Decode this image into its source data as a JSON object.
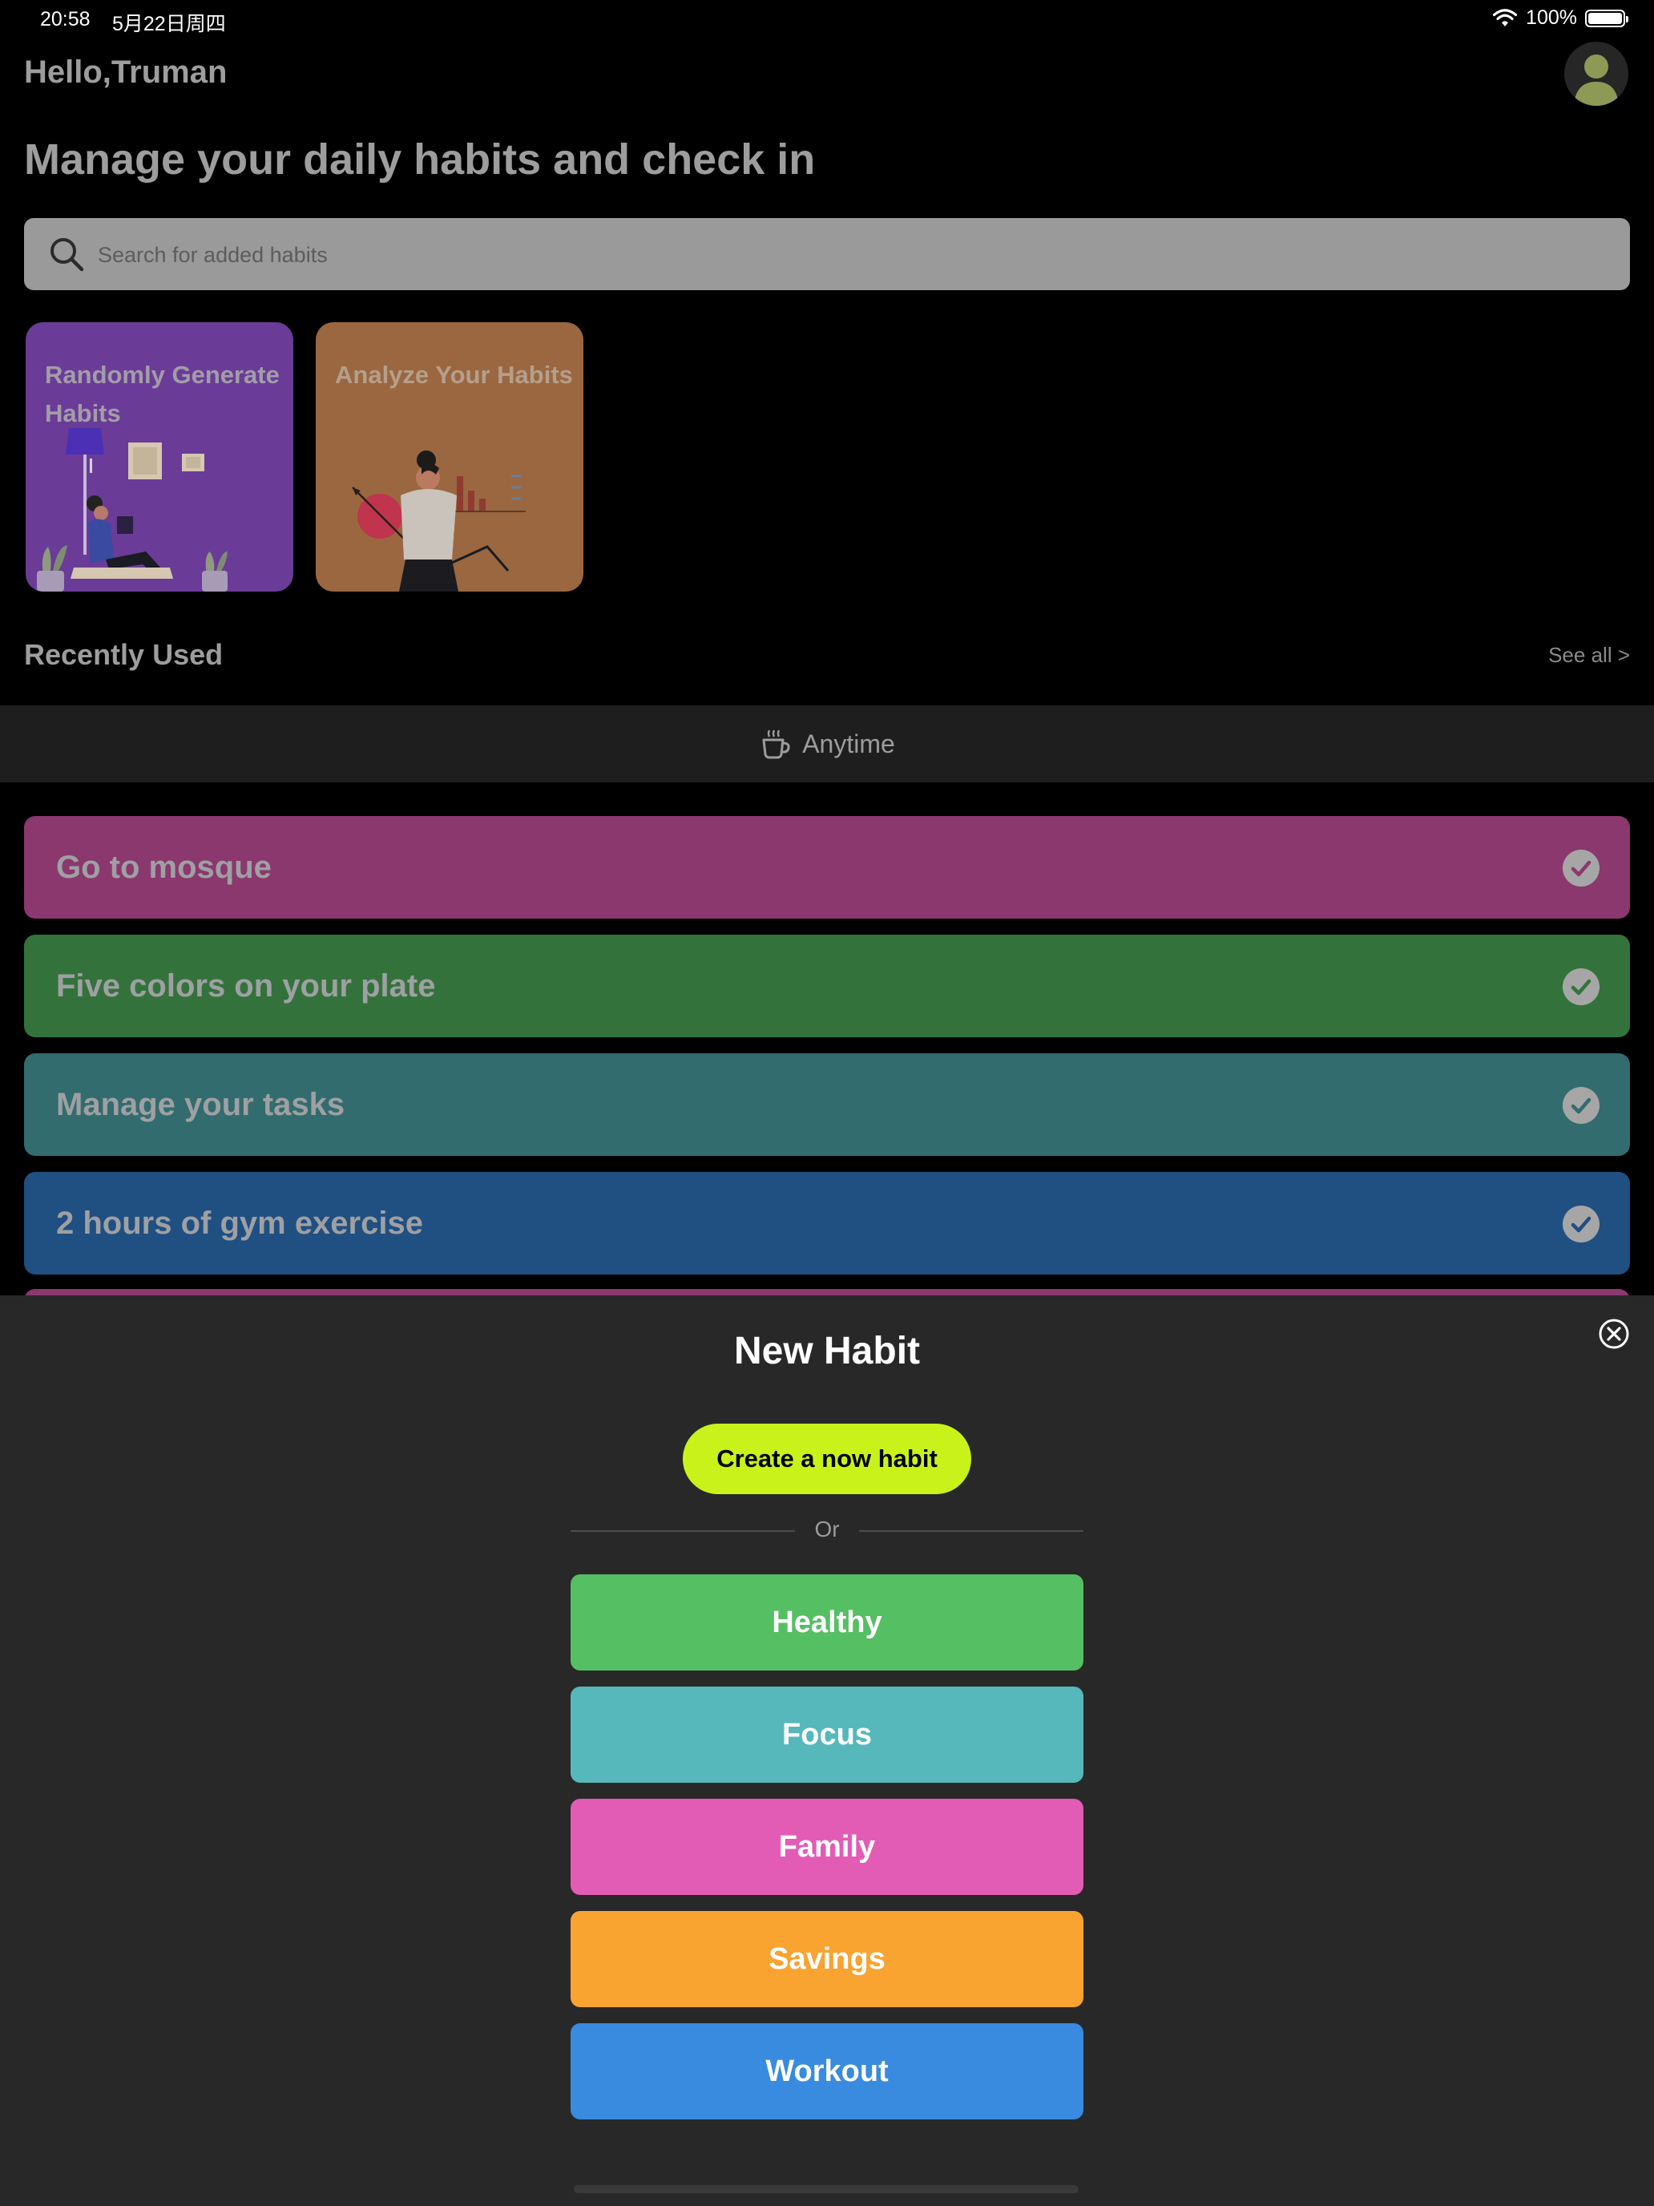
{
  "status_bar": {
    "time": "20:58",
    "date": "5月22日周四",
    "battery": "100%"
  },
  "header": {
    "greeting": "Hello,Truman"
  },
  "main": {
    "title": "Manage your daily habits and check in",
    "search": {
      "placeholder": "Search for added habits"
    },
    "feature_cards": [
      {
        "title": "Randomly Generate Habits",
        "color": "#6a3c98"
      },
      {
        "title": "Analyze Your Habits",
        "color": "#9a6741"
      }
    ],
    "recent": {
      "title": "Recently Used",
      "see_all": "See all >",
      "time_filter": "Anytime",
      "habits": [
        {
          "label": "Go to mosque",
          "color": "#8b386e"
        },
        {
          "label": "Five colors on your plate",
          "color": "#33733b"
        },
        {
          "label": "Manage your tasks",
          "color": "#326c6e"
        },
        {
          "label": "2 hours of gym exercise",
          "color": "#204f82"
        },
        {
          "label": "",
          "color": "#8b386e"
        }
      ]
    }
  },
  "sheet": {
    "title": "New Habit",
    "create_label": "Create a now habit",
    "or_label": "Or",
    "categories": [
      {
        "label": "Healthy",
        "color": "#55bf64"
      },
      {
        "label": "Focus",
        "color": "#56b8bb"
      },
      {
        "label": "Family",
        "color": "#e25cb6"
      },
      {
        "label": "Savings",
        "color": "#f9a331"
      },
      {
        "label": "Workout",
        "color": "#388bdf"
      }
    ]
  },
  "icons": [
    "search-icon",
    "avatar-icon",
    "coffee-cup-icon",
    "check-icon",
    "close-icon",
    "wifi-icon",
    "battery-icon"
  ],
  "accent_colors": {
    "create_button": "#c9f21b"
  }
}
